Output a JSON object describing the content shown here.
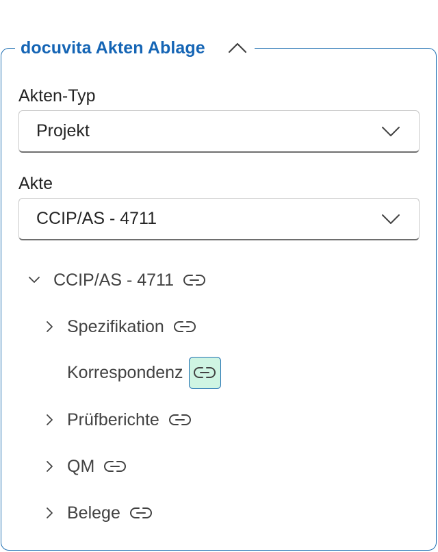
{
  "panel": {
    "title": "docuvita Akten Ablage"
  },
  "fields": {
    "type_label": "Akten-Typ",
    "type_value": "Projekt",
    "file_label": "Akte",
    "file_value": "CCIP/AS - 4711"
  },
  "tree": {
    "root": {
      "label": "CCIP/AS - 4711",
      "expanded": true
    },
    "children": [
      {
        "label": "Spezifikation",
        "expandable": true,
        "active": false
      },
      {
        "label": "Korrespondenz",
        "expandable": false,
        "active": true
      },
      {
        "label": "Prüfberichte",
        "expandable": true,
        "active": false
      },
      {
        "label": "QM",
        "expandable": true,
        "active": false
      },
      {
        "label": "Belege",
        "expandable": true,
        "active": false
      }
    ]
  },
  "colors": {
    "accent": "#1565b5",
    "active_bg": "#cff5e3",
    "text": "#242424"
  }
}
